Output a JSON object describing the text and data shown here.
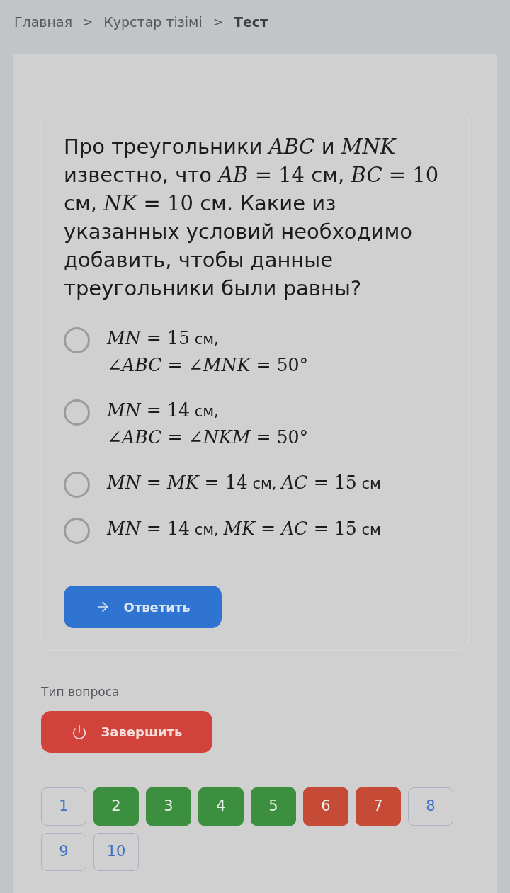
{
  "breadcrumb": [
    {
      "label": "Главная",
      "current": false
    },
    {
      "separator": ">",
      "label": "Курстар тізімі",
      "current": false
    },
    {
      "separator": ">",
      "label": "Тест",
      "current": true
    }
  ],
  "question": {
    "parts": [
      {
        "kind": "text",
        "text": "Про треугольники "
      },
      {
        "kind": "math",
        "text": "*ABC*"
      },
      {
        "kind": "text",
        "text": " и "
      },
      {
        "kind": "math",
        "text": "*MNK*"
      },
      {
        "kind": "text",
        "text": " известно, что "
      },
      {
        "kind": "math",
        "text": "*AB* = 14"
      },
      {
        "kind": "text",
        "text": " см, "
      },
      {
        "kind": "math",
        "text": "*BC* = 10"
      },
      {
        "kind": "text",
        "text": " см, "
      },
      {
        "kind": "math",
        "text": "*NK* = 10"
      },
      {
        "kind": "text",
        "text": " см. Какие из указанных условий необходимо добавить, чтобы данные треугольники были равны?"
      }
    ]
  },
  "options": [
    {
      "selected": false,
      "lines": [
        [
          {
            "kind": "math",
            "text": "*MN* = 15"
          },
          {
            "kind": "text",
            "text": " см,"
          }
        ],
        [
          {
            "kind": "math",
            "text": "∠*ABC* = ∠*MNK* = 50°"
          }
        ]
      ]
    },
    {
      "selected": false,
      "lines": [
        [
          {
            "kind": "math",
            "text": "*MN* = 14"
          },
          {
            "kind": "text",
            "text": " см,"
          }
        ],
        [
          {
            "kind": "math",
            "text": "∠*ABC* = ∠*NKM* = 50°"
          }
        ]
      ]
    },
    {
      "selected": false,
      "lines": [
        [
          {
            "kind": "math",
            "text": "*MN* = *MK* = 14"
          },
          {
            "kind": "text",
            "text": " см, "
          },
          {
            "kind": "math",
            "text": "*AC* = 15"
          },
          {
            "kind": "text",
            "text": " см"
          }
        ]
      ]
    },
    {
      "selected": false,
      "lines": [
        [
          {
            "kind": "math",
            "text": "*MN* = 14"
          },
          {
            "kind": "text",
            "text": " см, "
          },
          {
            "kind": "math",
            "text": "*MK* = *AC* = 15"
          },
          {
            "kind": "text",
            "text": " см"
          }
        ]
      ]
    }
  ],
  "answer_button": {
    "label": "Ответить"
  },
  "question_type_label": "Тип вопроса",
  "finish_button": {
    "label": "Завершить"
  },
  "pagination": [
    {
      "label": "1"
    },
    {
      "label": "2",
      "color": "#3b8f3f"
    },
    {
      "label": "3",
      "color": "#3b8f3f"
    },
    {
      "label": "4",
      "color": "#3b8f3f"
    },
    {
      "label": "5",
      "color": "#3b8f3f"
    },
    {
      "label": "6",
      "color": "#c54b37"
    },
    {
      "label": "7",
      "color": "#c54b37"
    },
    {
      "label": "8"
    },
    {
      "label": "9"
    },
    {
      "label": "10"
    }
  ]
}
